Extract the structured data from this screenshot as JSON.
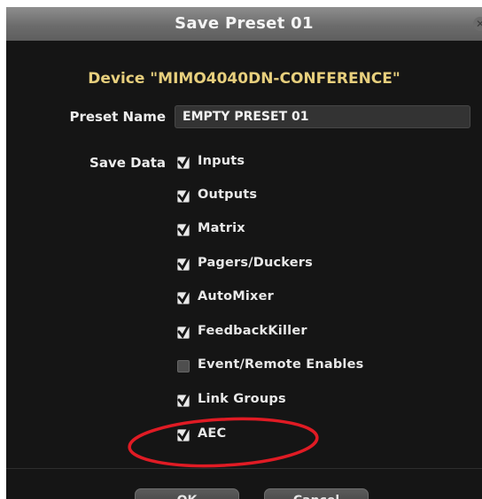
{
  "dialog": {
    "title": "Save Preset 01",
    "device_label": "Device \"MIMO4040DN-CONFERENCE\"",
    "preset_name_label": "Preset Name",
    "preset_name_value": "EMPTY PRESET 01",
    "save_data_label": "Save Data",
    "save_data_items": [
      {
        "label": "Inputs",
        "checked": true
      },
      {
        "label": "Outputs",
        "checked": true
      },
      {
        "label": "Matrix",
        "checked": true
      },
      {
        "label": "Pagers/Duckers",
        "checked": true
      },
      {
        "label": "AutoMixer",
        "checked": true
      },
      {
        "label": "FeedbackKiller",
        "checked": true
      },
      {
        "label": "Event/Remote Enables",
        "checked": false
      },
      {
        "label": "Link Groups",
        "checked": true
      },
      {
        "label": "AEC",
        "checked": true
      }
    ],
    "buttons": {
      "ok": "OK",
      "cancel": "Cancel"
    }
  },
  "colors": {
    "dialog_bg": "#151515",
    "device_text": "#e7cf7d",
    "annotation_ellipse": "#e01b24"
  }
}
